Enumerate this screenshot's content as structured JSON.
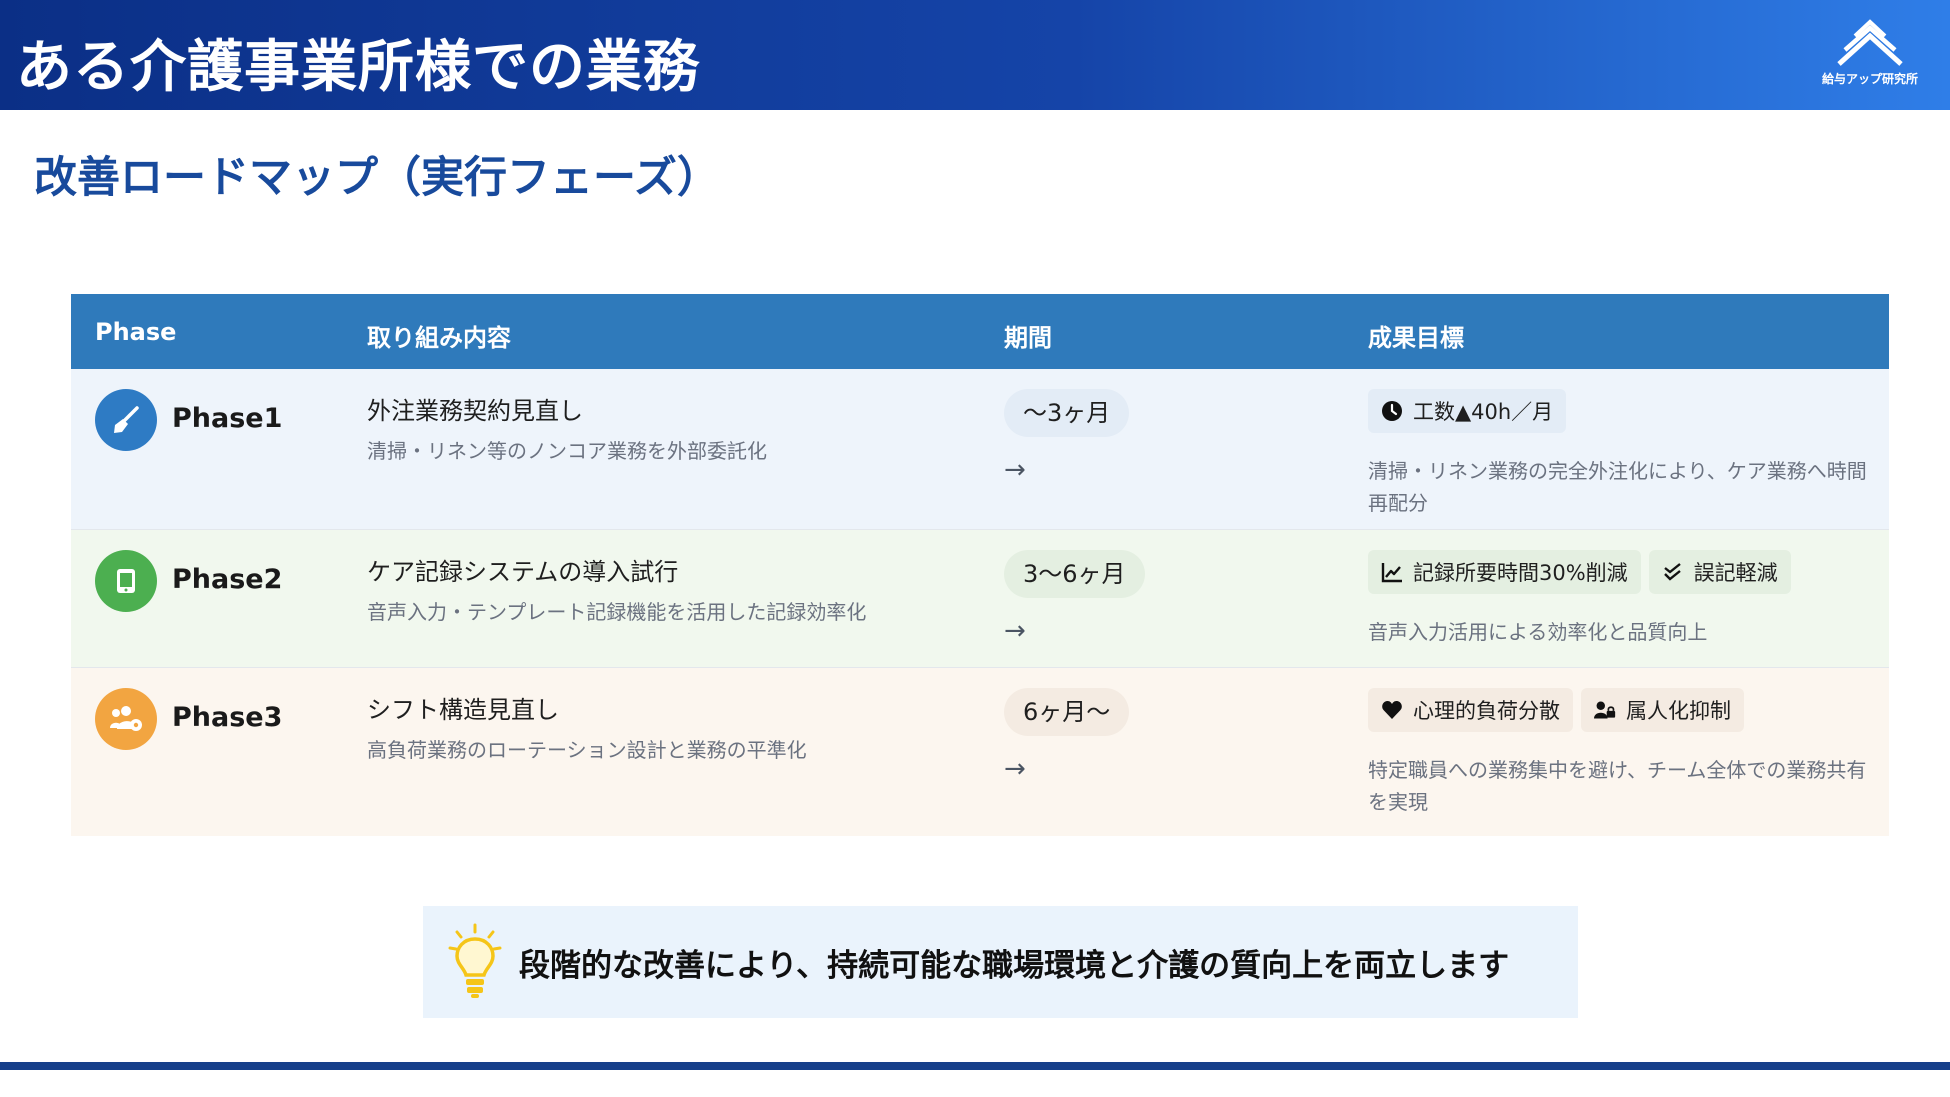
{
  "header": {
    "title": "ある介護事業所様での業務",
    "logo_text": "給与アップ研究所"
  },
  "subtitle": "改善ロードマップ（実行フェーズ）",
  "table": {
    "columns": [
      "Phase",
      "取り組み内容",
      "期間",
      "成果目標"
    ],
    "rows": [
      {
        "phase": "Phase1",
        "icon": "broom-icon",
        "color": "#2e7bc4",
        "task": "外注業務契約見直し",
        "task_desc": "清掃・リネン等のノンコア業務を外部委託化",
        "period": "〜3ヶ月",
        "arrow": "→",
        "tags": [
          {
            "icon": "clock-icon",
            "label": "工数▲40h／月"
          }
        ],
        "goal_desc": "清掃・リネン業務の完全外注化により、ケア業務へ時間再配分"
      },
      {
        "phase": "Phase2",
        "icon": "tablet-icon",
        "color": "#4caf50",
        "task": "ケア記録システムの導入試行",
        "task_desc": "音声入力・テンプレート記録機能を活用した記録効率化",
        "period": "3〜6ヶ月",
        "arrow": "→",
        "tags": [
          {
            "icon": "chart-line-icon",
            "label": "記録所要時間30%削減"
          },
          {
            "icon": "check-icon",
            "label": "誤記軽減"
          }
        ],
        "goal_desc": "音声入力活用による効率化と品質向上"
      },
      {
        "phase": "Phase3",
        "icon": "users-gear-icon",
        "color": "#f2a541",
        "task": "シフト構造見直し",
        "task_desc": "高負荷業務のローテーション設計と業務の平準化",
        "period": "6ヶ月〜",
        "arrow": "→",
        "tags": [
          {
            "icon": "heart-icon",
            "label": "心理的負荷分散"
          },
          {
            "icon": "user-lock-icon",
            "label": "属人化抑制"
          }
        ],
        "goal_desc": "特定職員への業務集中を避け、チーム全体での業務共有を実現"
      }
    ]
  },
  "callout": {
    "icon": "lightbulb-icon",
    "text": "段階的な改善により、持続可能な職場環境と介護の質向上を両立します"
  },
  "colors": {
    "header_start": "#0b2f86",
    "header_end": "#2f7ee8",
    "table_header": "#2f7abb",
    "subtitle": "#184a9c",
    "bottom_bar": "#163f8a"
  }
}
